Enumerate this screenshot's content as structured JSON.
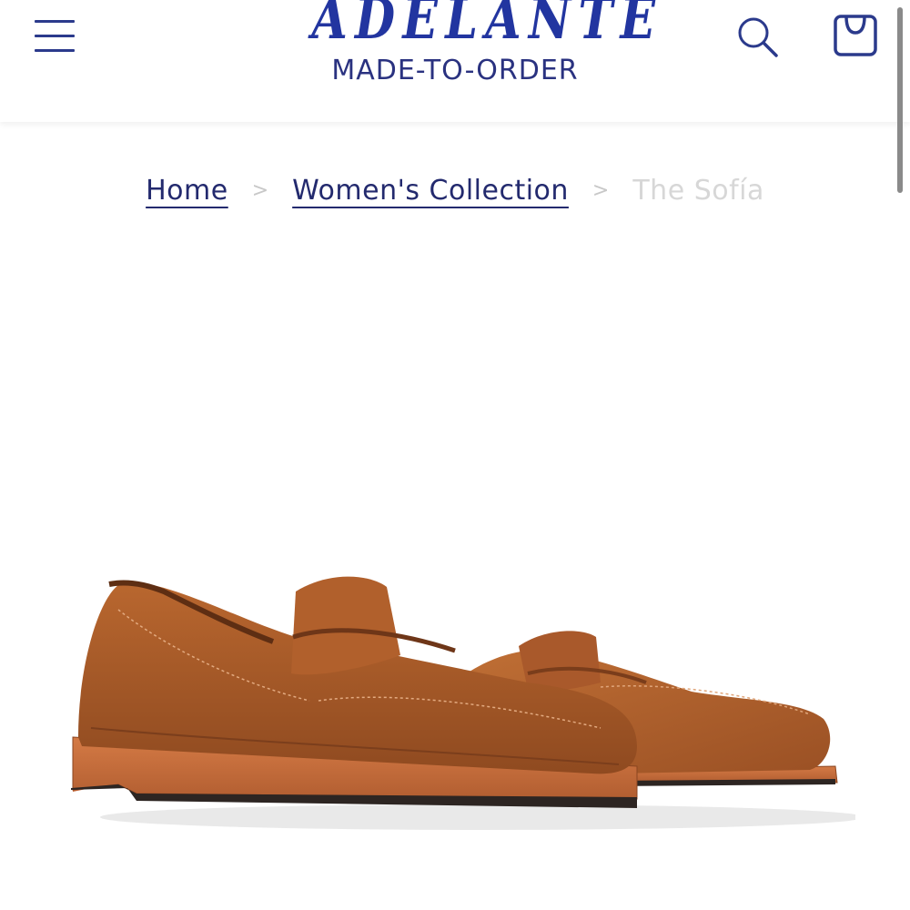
{
  "header": {
    "brand": "ADELANTE",
    "tagline": "MADE-TO-ORDER",
    "icons": {
      "menu": "hamburger-menu-icon",
      "search": "search-icon",
      "cart": "shopping-bag-icon"
    }
  },
  "breadcrumb": {
    "items": [
      {
        "label": "Home"
      },
      {
        "label": "Women's Collection"
      },
      {
        "label": "The Sofía"
      }
    ],
    "separator": ">"
  },
  "product": {
    "image": "brown-leather-penny-loafers-pair"
  },
  "colors": {
    "brand_blue": "#2235a0",
    "text_navy": "#232a6e",
    "leather": "#a8592b",
    "sole": "#c46b3c"
  }
}
